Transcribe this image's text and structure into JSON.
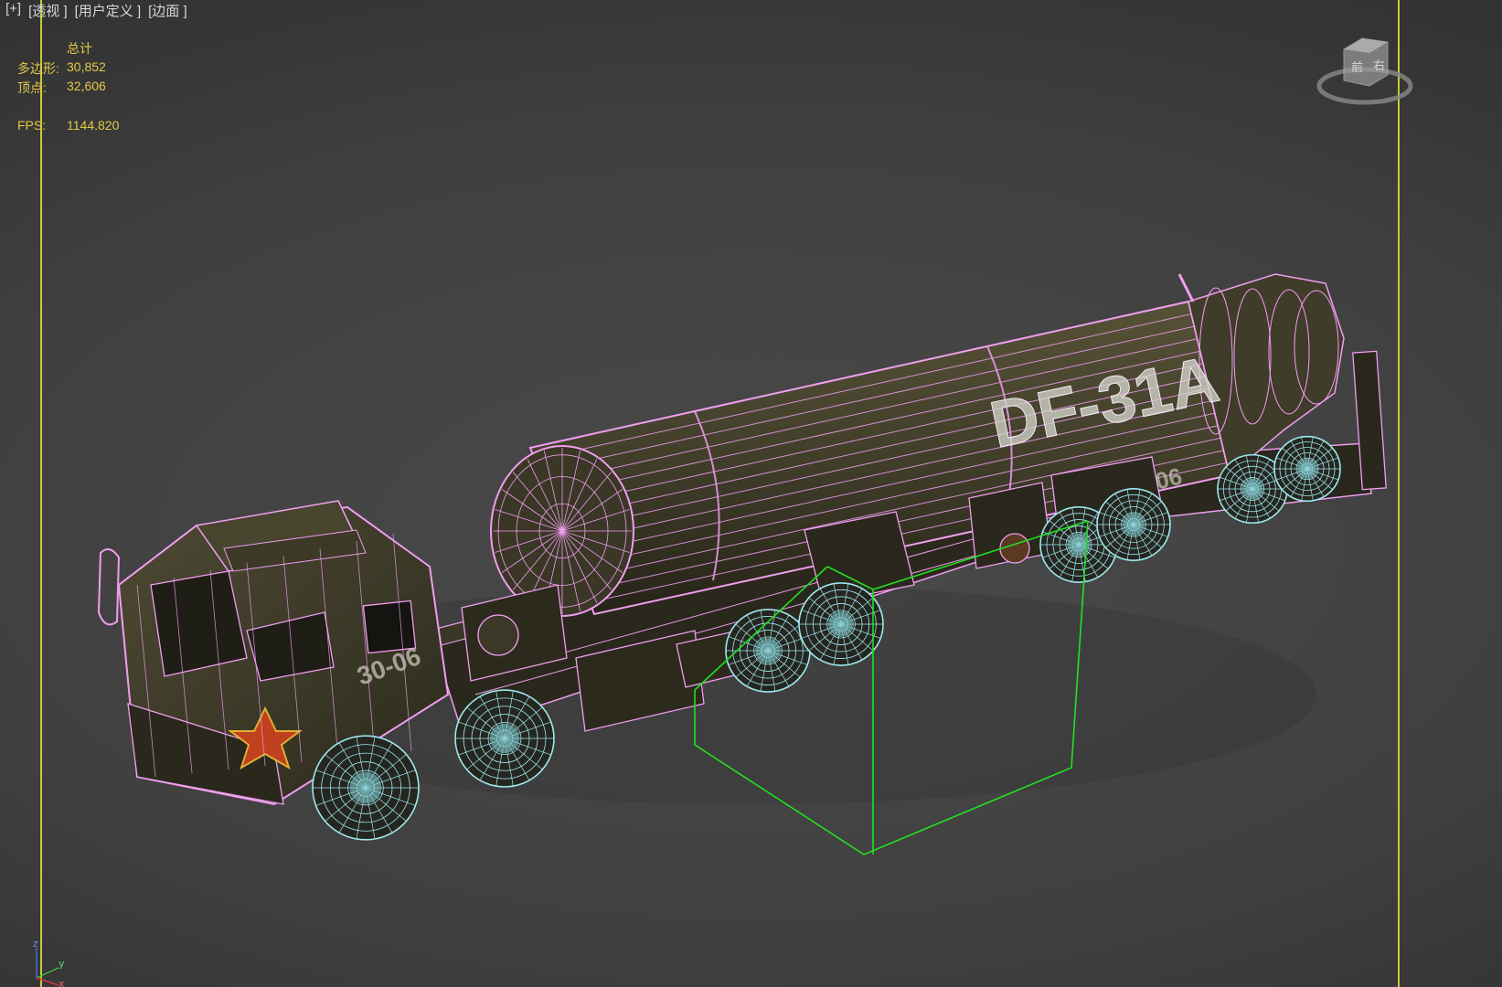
{
  "viewport": {
    "menu": [
      "[+]",
      "[透视 ]",
      "[用户定义 ]",
      "[边面 ]"
    ]
  },
  "stats": {
    "header": "总计",
    "polygons_label": "多边形:",
    "polygons_value": "30,852",
    "vertices_label": "顶点:",
    "vertices_value": "32,606",
    "fps_label": "FPS:",
    "fps_value": "1144.820"
  },
  "model": {
    "missile_marking": "DF-31A",
    "cab_number": "30-06",
    "trailer_number": "30-06"
  },
  "viewcube": {
    "face_label_1": "前",
    "face_label_2": "右"
  },
  "axis_gizmo": {
    "z_label": "z",
    "y_label": "y",
    "x_label": "x"
  },
  "colors": {
    "wire": "#f09ef0",
    "wheel_wire": "#9ee8ee",
    "body": "#3b3828",
    "bbox": "#22e022",
    "stats_text": "#e3c94a",
    "frame": "#c9c93a"
  }
}
